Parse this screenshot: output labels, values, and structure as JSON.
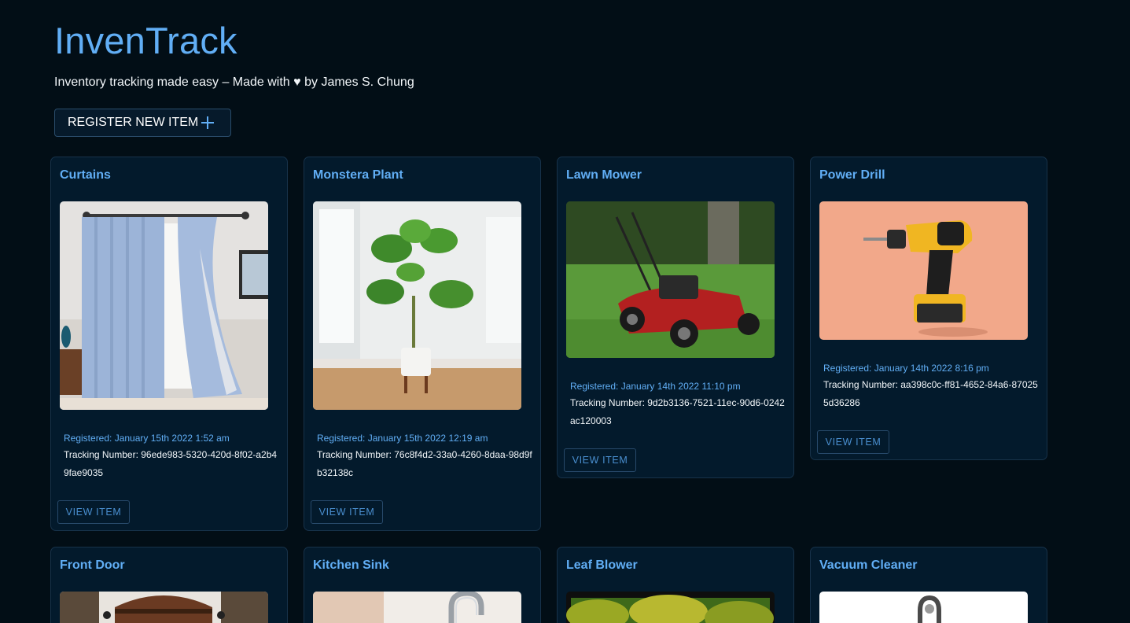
{
  "header": {
    "title": "InvenTrack",
    "tagline": "Inventory tracking made easy – Made with ♥ by James S. Chung",
    "register_label": "REGISTER NEW ITEM"
  },
  "items": [
    {
      "name": "Curtains",
      "registered": "Registered: January 15th 2022 1:52 am",
      "tracking": "Tracking Number: 96ede983-5320-420d-8f02-a2b49fae9035",
      "view_label": "VIEW ITEM"
    },
    {
      "name": "Monstera Plant",
      "registered": "Registered: January 15th 2022 12:19 am",
      "tracking": "Tracking Number: 76c8f4d2-33a0-4260-8daa-98d9fb32138c",
      "view_label": "VIEW ITEM"
    },
    {
      "name": "Lawn Mower",
      "registered": "Registered: January 14th 2022 11:10 pm",
      "tracking": "Tracking Number: 9d2b3136-7521-11ec-90d6-0242ac120003",
      "view_label": "VIEW ITEM"
    },
    {
      "name": "Power Drill",
      "registered": "Registered: January 14th 2022 8:16 pm",
      "tracking": "Tracking Number: aa398c0c-ff81-4652-84a6-870255d36286",
      "view_label": "VIEW ITEM"
    },
    {
      "name": "Front Door"
    },
    {
      "name": "Kitchen Sink"
    },
    {
      "name": "Leaf Blower"
    },
    {
      "name": "Vacuum Cleaner"
    }
  ],
  "colors": {
    "background": "#020e16",
    "card": "#031a2c",
    "accent": "#61aef5"
  }
}
